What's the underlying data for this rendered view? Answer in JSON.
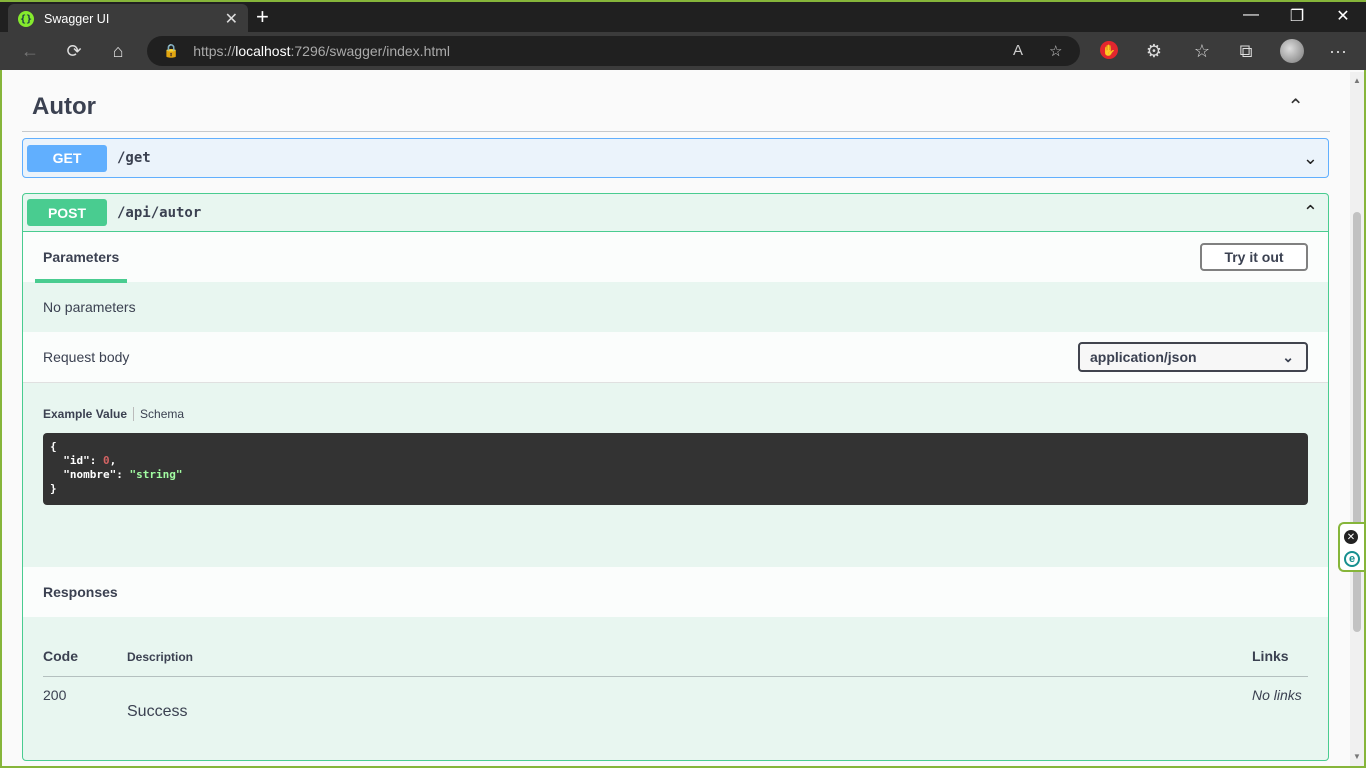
{
  "browser": {
    "tab_title": "Swagger UI",
    "url_prefix": "https://",
    "url_host": "localhost",
    "url_rest": ":7296/swagger/index.html"
  },
  "icons": {
    "back": "←",
    "refresh": "⟳",
    "home": "⌂",
    "lock": "🔒",
    "read_aloud": "A",
    "favorite_add": "☆",
    "extensions": "⚙",
    "favorites": "☆",
    "collections": "⧉",
    "more": "···",
    "close": "✕",
    "new_tab": "+",
    "minimize": "—",
    "restore": "❐",
    "chevron_up": "⌃",
    "chevron_down": "⌄",
    "favicon": "{}",
    "select_arrow": "⌄",
    "widget_close": "✕",
    "widget_e": "e"
  },
  "section": {
    "title": "Autor"
  },
  "operations": [
    {
      "method": "GET",
      "path": "/get"
    },
    {
      "method": "POST",
      "path": "/api/autor"
    }
  ],
  "post_details": {
    "tab_parameters": "Parameters",
    "try_it_out": "Try it out",
    "no_parameters": "No parameters",
    "request_body_label": "Request body",
    "content_type": "application/json",
    "example_value_tab": "Example Value",
    "schema_tab": "Schema",
    "example_json": {
      "id_key": "\"id\"",
      "id_value": "0",
      "nombre_key": "\"nombre\"",
      "nombre_value": "\"string\""
    },
    "responses_title": "Responses",
    "responses_table": {
      "headers": {
        "code": "Code",
        "description": "Description",
        "links": "Links"
      },
      "rows": [
        {
          "code": "200",
          "description": "Success",
          "links": "No links"
        }
      ]
    }
  },
  "colors": {
    "get": "#61affe",
    "post": "#49cc90",
    "accent_frame": "#86b53a"
  }
}
